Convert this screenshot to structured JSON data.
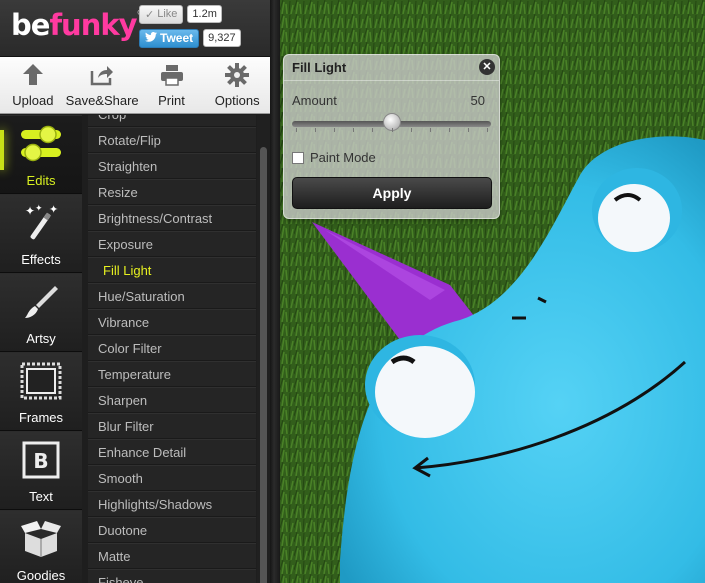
{
  "brand": {
    "logo_text_a": "be",
    "logo_text_b": "funky",
    "registered": "®"
  },
  "social": {
    "like_label": "Like",
    "like_count": "1.2m",
    "tweet_label": "Tweet",
    "tweet_count": "9,327"
  },
  "toolbar": {
    "items": [
      {
        "label": "Upload",
        "icon": "upload-icon"
      },
      {
        "label": "Save&Share",
        "icon": "share-icon"
      },
      {
        "label": "Print",
        "icon": "print-icon"
      },
      {
        "label": "Options",
        "icon": "gear-icon"
      }
    ]
  },
  "categories": [
    {
      "label": "Edits",
      "icon": "toggles-icon",
      "active": true
    },
    {
      "label": "Effects",
      "icon": "magic-wand-icon"
    },
    {
      "label": "Artsy",
      "icon": "paintbrush-icon"
    },
    {
      "label": "Frames",
      "icon": "frame-icon"
    },
    {
      "label": "Text",
      "icon": "text-icon"
    },
    {
      "label": "Goodies",
      "icon": "box-icon"
    }
  ],
  "tools": [
    "Crop",
    "Rotate/Flip",
    "Straighten",
    "Resize",
    "Brightness/Contrast",
    "Exposure",
    "Fill Light",
    "Hue/Saturation",
    "Vibrance",
    "Color Filter",
    "Temperature",
    "Sharpen",
    "Blur Filter",
    "Enhance Detail",
    "Smooth",
    "Highlights/Shadows",
    "Duotone",
    "Matte",
    "Fisheye"
  ],
  "active_tool": "Fill Light",
  "panel": {
    "title": "Fill Light",
    "close_glyph": "✕",
    "amount_label": "Amount",
    "amount_value": "50",
    "amount_fraction": 0.5,
    "paint_mode_label": "Paint Mode",
    "paint_mode_checked": false,
    "apply_label": "Apply"
  },
  "colors": {
    "accent": "#d8f020",
    "logo_pink": "#ff3aa0",
    "character_blue": "#3cc4ea",
    "horn_purple": "#9a2fd0",
    "grass": "#2f5a1a"
  }
}
